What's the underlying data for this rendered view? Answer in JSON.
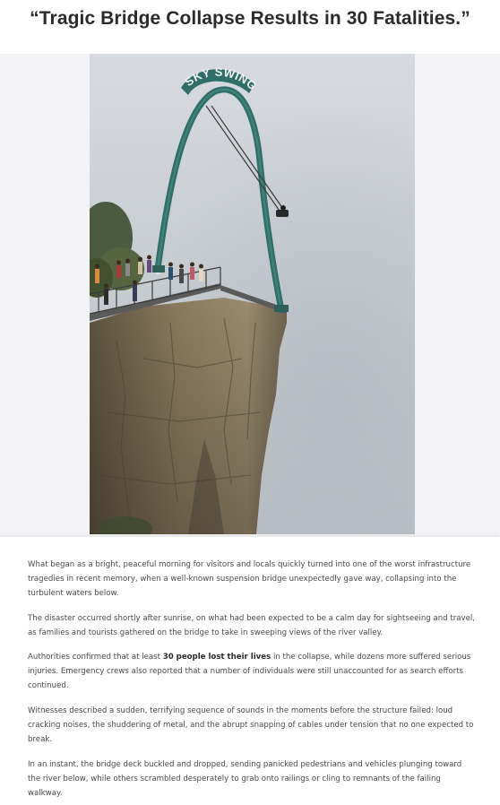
{
  "headline": "“Tragic Bridge Collapse Results in 30 Fatalities.”",
  "photo": {
    "sign_text": "SKY SWING",
    "alt": "Sky swing arch on a cliff edge in fog"
  },
  "article": {
    "paragraph_1": "What began as a bright, peaceful morning for visitors and locals quickly turned into one of the worst infrastructure tragedies in recent memory, when a well-known suspension bridge unexpectedly gave way, collapsing into the turbulent waters below.",
    "paragraph_2": "The disaster occurred shortly after sunrise, on what had been expected to be a calm day for sightseeing and travel, as families and tourists gathered on the bridge to take in sweeping views of the river valley.",
    "paragraph_3_before": "Authorities confirmed that at least ",
    "paragraph_3_bold": "30 people lost their lives",
    "paragraph_3_after": " in the collapse, while dozens more suffered serious injuries. Emergency crews also reported that a number of individuals were still unaccounted for as search efforts continued.",
    "paragraph_4": "Witnesses described a sudden, terrifying sequence of sounds in the moments before the structure failed: loud cracking noises, the shuddering of metal, and the abrupt snapping of cables under tension that no one expected to break.",
    "paragraph_5": "In an instant, the bridge deck buckled and dropped, sending panicked pedestrians and vehicles plunging toward the river below, while others scrambled desperately to grab onto railings or cling to remnants of the failing walkway."
  },
  "colors": {
    "fog": "#c9ced3",
    "arch": "#2f6f68",
    "cliff": "#7a6a52",
    "text": "#4a4a4a"
  }
}
